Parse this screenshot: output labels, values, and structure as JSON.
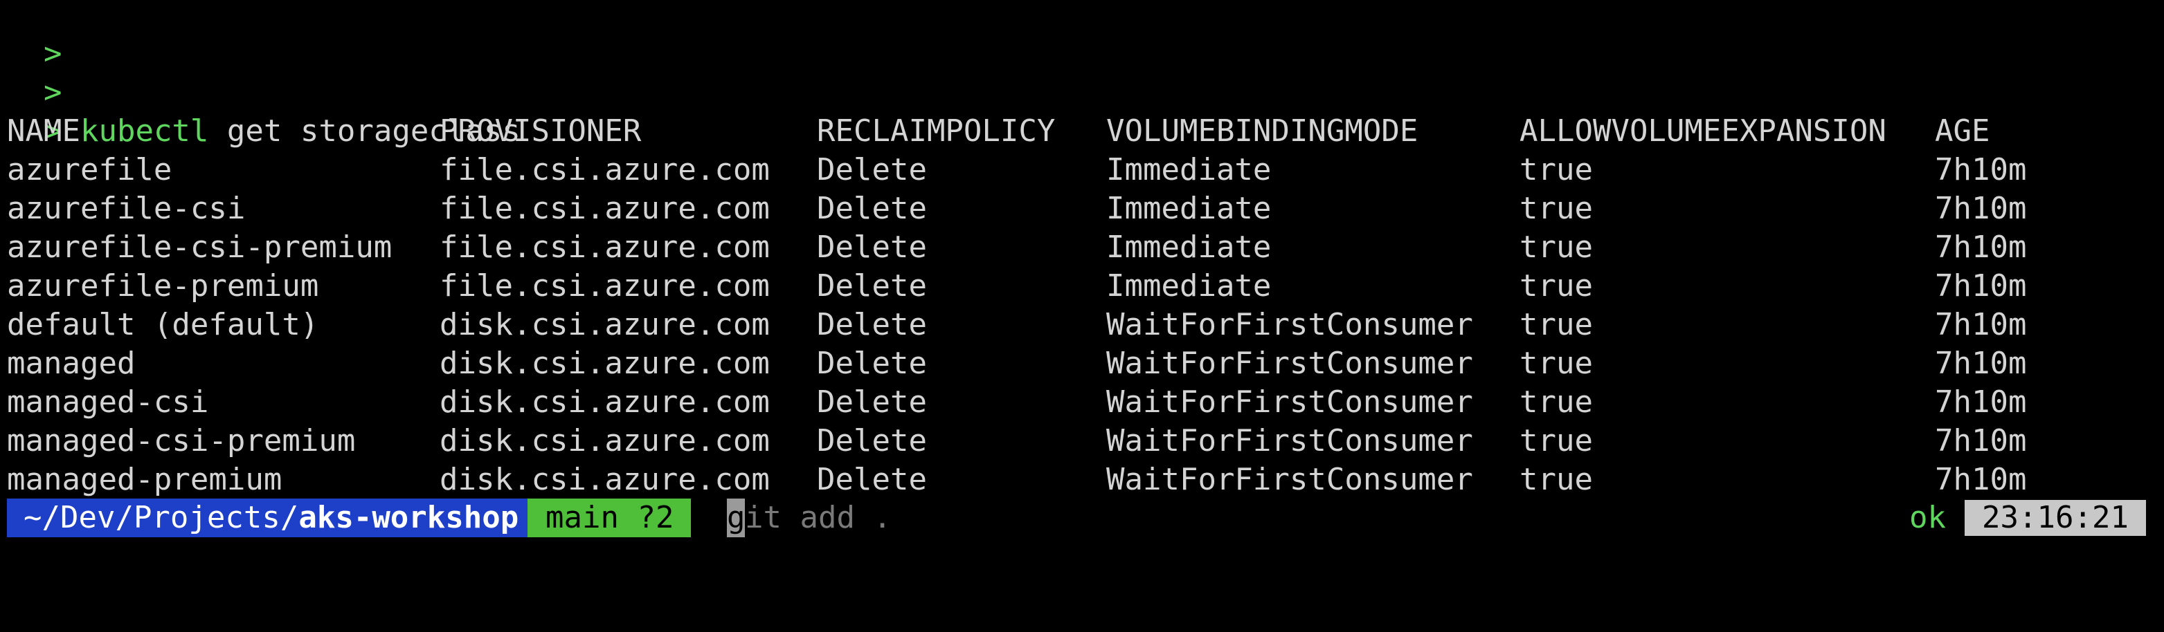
{
  "terminal": {
    "prompt_symbol": ">",
    "history_lines": [
      ">",
      ">"
    ],
    "command": {
      "program": "kubectl",
      "args": " get storageclass"
    }
  },
  "table": {
    "headers": [
      "NAME",
      "PROVISIONER",
      "RECLAIMPOLICY",
      "VOLUMEBINDINGMODE",
      "ALLOWVOLUMEEXPANSION",
      "AGE"
    ],
    "rows": [
      [
        "azurefile",
        "file.csi.azure.com",
        "Delete",
        "Immediate",
        "true",
        "7h10m"
      ],
      [
        "azurefile-csi",
        "file.csi.azure.com",
        "Delete",
        "Immediate",
        "true",
        "7h10m"
      ],
      [
        "azurefile-csi-premium",
        "file.csi.azure.com",
        "Delete",
        "Immediate",
        "true",
        "7h10m"
      ],
      [
        "azurefile-premium",
        "file.csi.azure.com",
        "Delete",
        "Immediate",
        "true",
        "7h10m"
      ],
      [
        "default (default)",
        "disk.csi.azure.com",
        "Delete",
        "WaitForFirstConsumer",
        "true",
        "7h10m"
      ],
      [
        "managed",
        "disk.csi.azure.com",
        "Delete",
        "WaitForFirstConsumer",
        "true",
        "7h10m"
      ],
      [
        "managed-csi",
        "disk.csi.azure.com",
        "Delete",
        "WaitForFirstConsumer",
        "true",
        "7h10m"
      ],
      [
        "managed-csi-premium",
        "disk.csi.azure.com",
        "Delete",
        "WaitForFirstConsumer",
        "true",
        "7h10m"
      ],
      [
        "managed-premium",
        "disk.csi.azure.com",
        "Delete",
        "WaitForFirstConsumer",
        "true",
        "7h10m"
      ]
    ]
  },
  "prompt": {
    "path_prefix": "~/Dev/Projects/",
    "path_last": "aks-workshop",
    "git_status": "main ?2",
    "cursor_char": "g",
    "suggestion": "it add .",
    "status": "ok",
    "time": "23:16:21"
  },
  "colors": {
    "background": "#000000",
    "prompt_green": "#5fd75f",
    "path_segment": "#1e3fc8",
    "git_segment": "#4fbf3a",
    "clock_segment": "#c8c8c8"
  }
}
